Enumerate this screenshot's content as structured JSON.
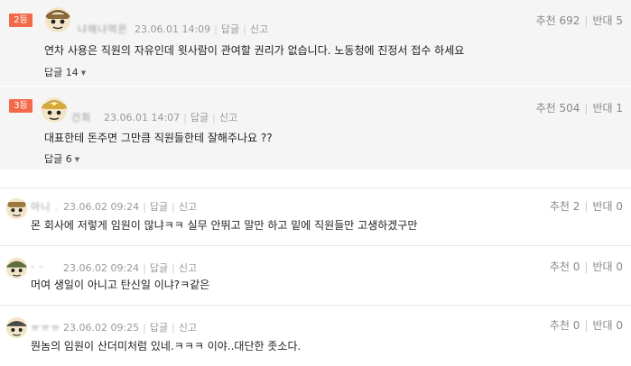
{
  "best_comments": [
    {
      "rank": "2등",
      "nickname": "냐해냐먹은",
      "date": "23.06.01 14:09",
      "reply_label": "답글",
      "report_label": "신고",
      "upvote": "추천 692",
      "downvote": "반대 5",
      "text": "연차 사용은 직원의 자유인데 윗사람이 관여할 권리가 없습니다. 노동청에 진정서 접수 하세요",
      "replies": "답글 14"
    },
    {
      "rank": "3등",
      "nickname": "건희",
      "date": "23.06.01 14:07",
      "reply_label": "답글",
      "report_label": "신고",
      "upvote": "추천 504",
      "downvote": "반대 1",
      "text": "대표한테 돈주면 그만큼 직원들한테 잘해주나요 ??",
      "replies": "답글 6"
    }
  ],
  "comments": [
    {
      "nickname": "아니 .",
      "date": "23.06.02 09:24",
      "reply_label": "답글",
      "report_label": "신고",
      "upvote": "추천 2",
      "downvote": "반대 0",
      "text": "몬 회사에 저렇게 임원이 많냐ㅋㅋ 실무 안뛰고 말만 하고 밑에 직원들만 고생하겠구만"
    },
    {
      "nickname": "- -",
      "date": "23.06.02 09:24",
      "reply_label": "답글",
      "report_label": "신고",
      "upvote": "추천 0",
      "downvote": "반대 0",
      "text": "머여 생일이 아니고 탄신일 이냐?ㅋ같은"
    },
    {
      "nickname": "ㅠㅠㅠ",
      "date": "23.06.02 09:25",
      "reply_label": "답글",
      "report_label": "신고",
      "upvote": "추천 0",
      "downvote": "반대 0",
      "text": "뭔놈의 임원이 산더미처럼 있네.ㅋㅋㅋ 이야..대단한 좃소다."
    }
  ],
  "colors": {
    "rank_badge": "#f26a4b",
    "best_bg": "#f5f5f5",
    "divider": "#e6e6e6"
  },
  "icons": [
    "avatar-icon",
    "caret-down-icon"
  ]
}
